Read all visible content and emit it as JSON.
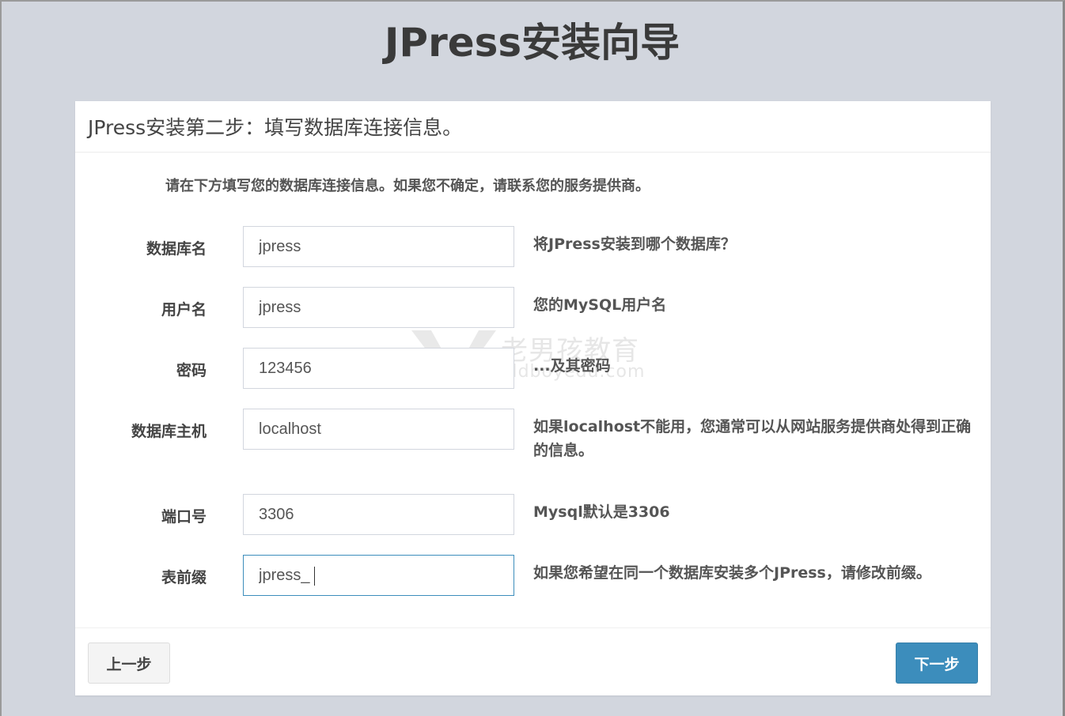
{
  "page": {
    "title": "JPress安装向导"
  },
  "panel": {
    "header": "JPress安装第二步：填写数据库连接信息。",
    "intro": "请在下方填写您的数据库连接信息。如果您不确定，请联系您的服务提供商。"
  },
  "fields": [
    {
      "label": "数据库名",
      "value": "jpress",
      "help": "将JPress安装到哪个数据库？"
    },
    {
      "label": "用户名",
      "value": "jpress",
      "help": "您的MySQL用户名"
    },
    {
      "label": "密码",
      "value": "123456",
      "help": "...及其密码"
    },
    {
      "label": "数据库主机",
      "value": "localhost",
      "help": "如果localhost不能用，您通常可以从网站服务提供商处得到正确的信息。"
    },
    {
      "label": "端口号",
      "value": "3306",
      "help": "Mysql默认是3306"
    },
    {
      "label": "表前缀",
      "value": "jpress_",
      "help": "如果您希望在同一个数据库安装多个JPress，请修改前缀。"
    }
  ],
  "watermark": {
    "line1": "老男孩教育",
    "line2": "oldboyedu.com"
  },
  "buttons": {
    "prev": "上一步",
    "next": "下一步"
  },
  "colors": {
    "background": "#d2d6de",
    "primary": "#3c8dbc",
    "panel": "#ffffff"
  }
}
